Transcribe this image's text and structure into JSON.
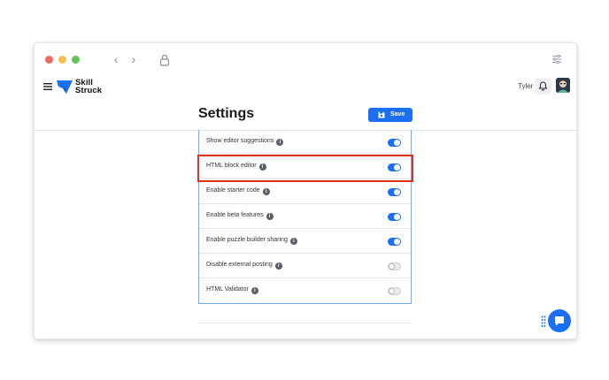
{
  "app": {
    "brand_line1": "Skill",
    "brand_line2": "Struck",
    "user_name": "Tyler"
  },
  "page": {
    "title": "Settings",
    "save_label": "Save"
  },
  "settings": [
    {
      "label": "Show editor suggestions",
      "enabled": true
    },
    {
      "label": "HTML block editor",
      "enabled": true,
      "highlighted": true
    },
    {
      "label": "Enable starter code",
      "enabled": true
    },
    {
      "label": "Enable beta features",
      "enabled": true
    },
    {
      "label": "Enable puzzle builder sharing",
      "enabled": true
    },
    {
      "label": "Disable external posting",
      "enabled": false
    },
    {
      "label": "HTML Validator",
      "enabled": false
    }
  ],
  "colors": {
    "accent": "#1b6ff2",
    "highlight": "#e0311c"
  },
  "icons": {
    "info": "info-icon",
    "bell": "bell-icon",
    "chat": "chat-icon",
    "save": "save-icon"
  }
}
